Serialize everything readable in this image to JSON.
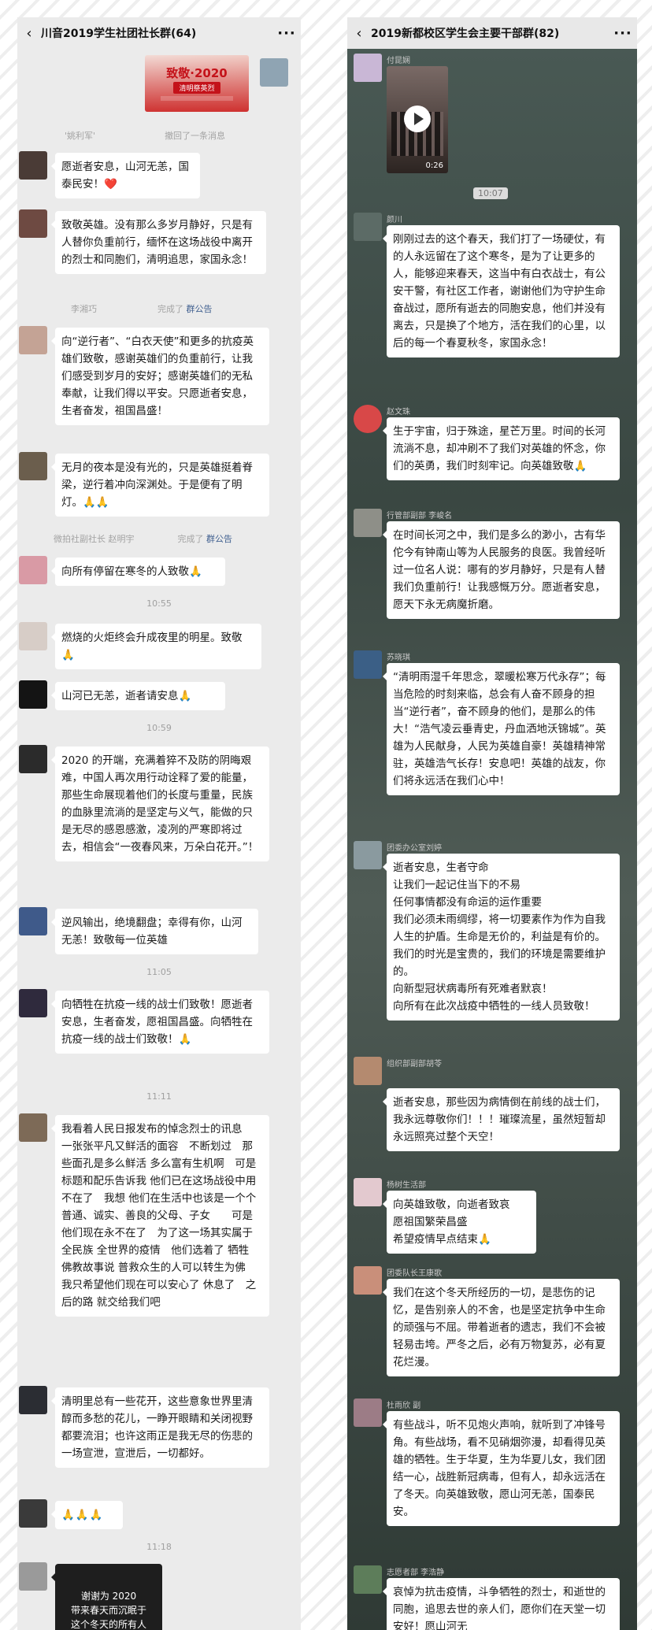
{
  "left": {
    "header": {
      "back": "‹",
      "title": "川音2019学生社团社长群(64)",
      "more": "···"
    },
    "poster": {
      "title": "致敬·2020",
      "subtitle": "清明祭英烈"
    },
    "sys1": {
      "name": "'姚利军'",
      "action": "撤回了一条消息"
    },
    "sys2": {
      "name": "李湘巧",
      "action": "完成了",
      "link": "群公告"
    },
    "sys3": {
      "name": "微拍社副社长 赵明宇",
      "action": "完成了",
      "link": "群公告"
    },
    "times": [
      "10:55",
      "10:59",
      "11:05",
      "11:11",
      "11:18"
    ],
    "messages": [
      "愿逝者安息，山河无恙，国泰民安！❤️",
      "致敬英雄。没有那么多岁月静好，只是有人替你负重前行，缅怀在这场战役中离开的烈士和同胞们，清明追思，家国永念！",
      "向“逆行者”、“白衣天使”和更多的抗疫英雄们致敬，感谢英雄们的负重前行，让我们感受到岁月的安好；感谢英雄们的无私奉献，让我们得以平安。只愿逝者安息，生者奋发，祖国昌盛！",
      "无月的夜本是没有光的，只是英雄挺着脊梁，逆行着冲向深渊处。于是便有了明灯。🙏🙏",
      "向所有停留在寒冬的人致敬🙏",
      "燃烧的火炬终会升成夜里的明星。致敬🙏",
      "山河已无恙，逝者请安息🙏",
      "2020 的开端，充满着猝不及防的阴晦艰难，中国人再次用行动诠释了爱的能量，那些生命展现着他们的长度与重量，民族的血脉里流淌的是坚定与义气，能做的只是无尽的感恩感激，凌冽的严寒即将过去，相信会“一夜春风来，万朵白花开。”！",
      "逆风输出，绝境翻盘；幸得有你，山河无恙！致敬每一位英雄",
      "向牺牲在抗疫一线的战士们致敬！愿逝者安息，生者奋发，愿祖国昌盛。向牺牲在抗疫一线的战士们致敬！🙏",
      "我看着人民日报发布的悼念烈士的讯息　一张张平凡又鲜活的面容　不断划过　那些面孔是多么鲜活 多么富有生机啊　可是标题和配乐告诉我 他们已在这场战役中用不在了　我想 他们在生活中也该是一个个普通、诚实、善良的父母、子女　　可是他们现在永不在了　为了这一场其实属于全民族 全世界的疫情　他们选着了 牺牲　佛教故事说 普救众生的人可以转生为佛　我只希望他们现在可以安心了 休息了　之后的路 就交给我们吧",
      "清明里总有一些花开，这些意象世界里清醇而多愁的花儿，一睁开眼睛和关闭视野都要流泪；也许这雨正是我无尽的伤悲的一场宣泄，宣泄后，一切都好。",
      "🙏🙏🙏",
      "谢谢为 2020\n带来春天而沉眠于\n这个冬天的所有人"
    ]
  },
  "right": {
    "header": {
      "back": "‹",
      "title": "2019新都校区学生会主要干部群(82)",
      "more": "···"
    },
    "video": {
      "duration": "0:26"
    },
    "times": [
      "10:07"
    ],
    "senders": [
      "付昆娴",
      "颜川",
      "赵文珠",
      "行管部副部 李峻名",
      "苏晓琪",
      "团委办公室刘婷",
      "组织部副部胡苓",
      "杨树生活部",
      "团委队长王康歌",
      "杜雨欣 副",
      "志愿者部 李浩静"
    ],
    "messages": [
      "刚刚过去的这个春天，我们打了一场硬仗，有的人永远留在了这个寒冬，是为了让更多的人，能够迎来春天，这当中有白衣战士，有公安干警，有社区工作者，谢谢他们为守护生命奋战过，愿所有逝去的同胞安息，他们并没有离去，只是换了个地方，活在我们的心里，以后的每一个春夏秋冬，家国永念！",
      "生于宇宙，归于殊途，星芒万里。时间的长河流淌不息，却冲刷不了我们对英雄的怀念，你们的英勇，我们时刻牢记。向英雄致敬🙏",
      "在时间长河之中，我们是多么的渺小，古有华佗今有钟南山等为人民服务的良医。我曾经听过一位名人说：哪有的岁月静好，只是有人替我们负重前行！让我感慨万分。愿逝者安息，愿天下永无病魔折磨。",
      "“清明雨湿千年思念，翠暖松寒万代永存”；每当危险的时刻来临，总会有人奋不顾身的担当“逆行者”，奋不顾身的他们，是那么的伟大！“浩气凌云垂青史，丹血洒地沃锦城”。英雄为人民献身，人民为英雄自豪！英雄精神常驻，英雄浩气长存！安息吧！英雄的战友，你们将永远活在我们心中！",
      "逝者安息，生者守命\n让我们一起记住当下的不易\n任何事情都没有命运的运作重要\n我们必须未雨绸缪，将一切要素作为作为自我人生的护盾。生命是无价的，利益是有价的。我们的时光是宝贵的，我们的环境是需要维护的。\n向新型冠状病毒所有死难者默哀！\n向所有在此次战疫中牺牲的一线人员致敬！",
      "逝者安息，那些因为病情倒在前线的战士们，我永远尊敬你们！！！璀璨流星，虽然短暂却永远照亮过整个天空！",
      "向英雄致敬，向逝者致哀\n愿祖国繁荣昌盛\n希望疫情早点结束🙏",
      "我们在这个冬天所经历的一切，是悲伤的记忆，是告别亲人的不舍，也是坚定抗争中生命的顽强与不屈。带着逝者的遗志，我们不会被轻易击垮。严冬之后，必有万物复苏，必有夏花烂漫。",
      "有些战斗，听不见炮火声响，就听到了冲锋号角。有些战场，看不见硝烟弥漫，却看得见英雄的牺牲。生于华夏，生为华夏儿女，我们团结一心，战胜新冠病毒，但有人，却永远活在了冬天。向英雄致敬，愿山河无恙，国泰民安。",
      "哀悼为抗击疫情，斗争牺牲的烈士，和逝世的同胞，追思去世的亲人们，愿你们在天堂一切安好！愿山河无"
    ]
  },
  "colors": {
    "left_bg": "#ebebeb",
    "bubble": "#ffffff",
    "link": "#3f5f8f",
    "time_text": "#a0a0a0"
  }
}
